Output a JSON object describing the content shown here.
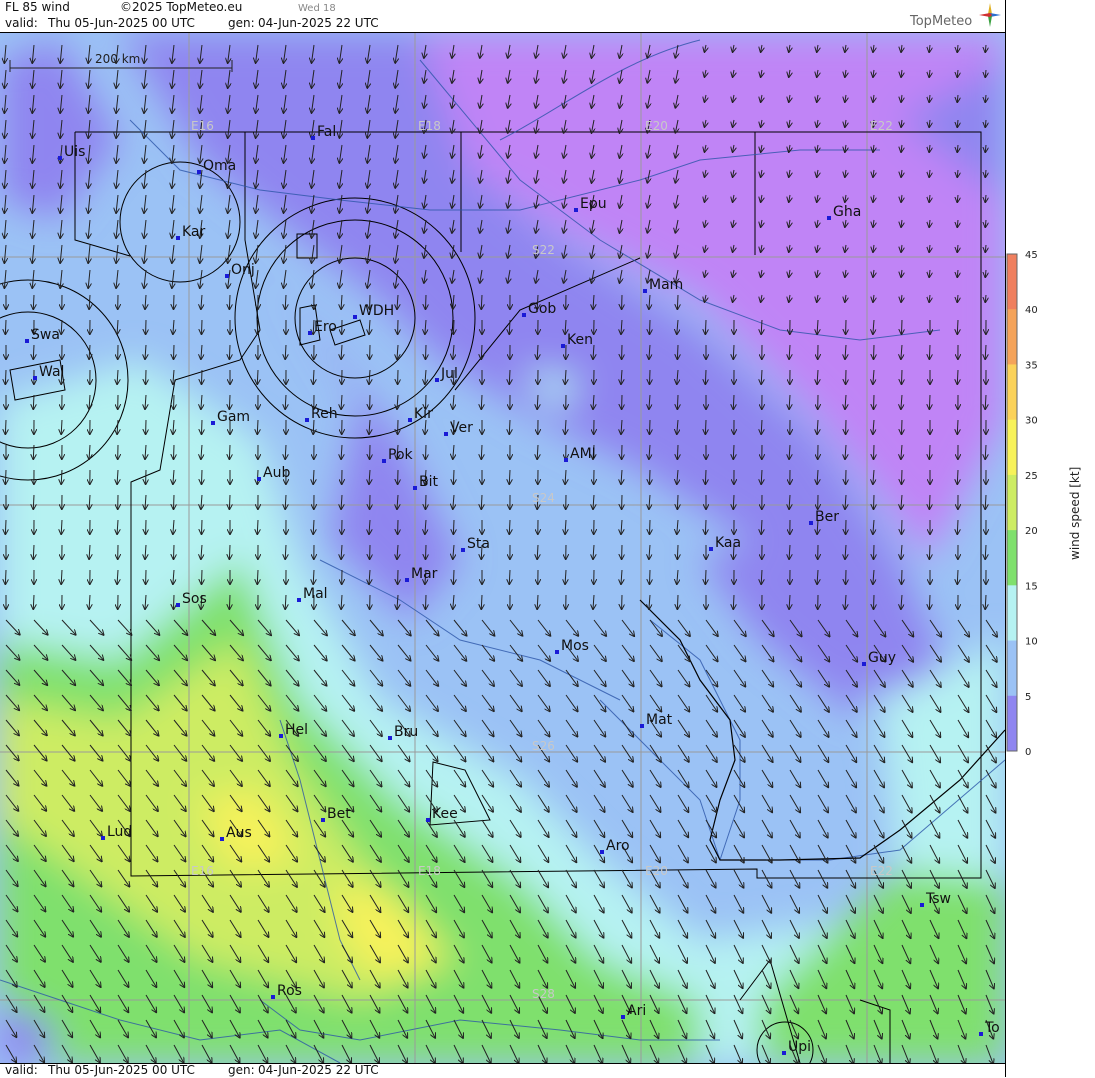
{
  "header": {
    "title": "FL 85 wind",
    "copyright": "©2025 TopMeteo.eu",
    "valid_label": "valid:",
    "valid_value": "Thu  05-Jun-2025  00 UTC",
    "gen_label": "gen:",
    "gen_value": "04-Jun-2025 22 UTC",
    "watermark": "Wed 18",
    "logo": "TopMeteo"
  },
  "footer": {
    "valid_label": "valid:",
    "valid_value": "Thu  05-Jun-2025  00 UTC",
    "gen_label": "gen:",
    "gen_value": "04-Jun-2025 22 UTC"
  },
  "scale_bar": {
    "label": "200 km"
  },
  "legend": {
    "title": "wind  speed  [kt]",
    "ticks": [
      "45",
      "40",
      "35",
      "30",
      "25",
      "20",
      "15",
      "10",
      "5",
      "0"
    ],
    "colors": [
      "#ef7f5e",
      "#f4a35a",
      "#fbd25a",
      "#f7f25a",
      "#cdec63",
      "#7fe06d",
      "#b6f2f2",
      "#9bc2f5",
      "#8f85f0",
      "#c084f6"
    ]
  },
  "grid_labels": {
    "lon": [
      "E16",
      "E18",
      "E20",
      "E22"
    ],
    "lat": [
      "S22",
      "S24",
      "S26",
      "S28"
    ]
  },
  "places": [
    {
      "name": "Uis"
    },
    {
      "name": "Oma"
    },
    {
      "name": "Fal"
    },
    {
      "name": "Kar"
    },
    {
      "name": "Onj"
    },
    {
      "name": "Epu"
    },
    {
      "name": "Gha"
    },
    {
      "name": "Mam"
    },
    {
      "name": "Gob"
    },
    {
      "name": "Ken"
    },
    {
      "name": "Swa"
    },
    {
      "name": "Wal"
    },
    {
      "name": "Ero"
    },
    {
      "name": "WDH"
    },
    {
      "name": "Jul"
    },
    {
      "name": "Gam"
    },
    {
      "name": "Reh"
    },
    {
      "name": "Kir"
    },
    {
      "name": "Ver"
    },
    {
      "name": "Pok"
    },
    {
      "name": "AMI"
    },
    {
      "name": "Bit"
    },
    {
      "name": "Aub"
    },
    {
      "name": "Ber"
    },
    {
      "name": "Sta"
    },
    {
      "name": "Kaa"
    },
    {
      "name": "Mar"
    },
    {
      "name": "Sos"
    },
    {
      "name": "Mal"
    },
    {
      "name": "Mos"
    },
    {
      "name": "Guy"
    },
    {
      "name": "Mat"
    },
    {
      "name": "Hel"
    },
    {
      "name": "Bru"
    },
    {
      "name": "Bet"
    },
    {
      "name": "Kee"
    },
    {
      "name": "Lud"
    },
    {
      "name": "Aus"
    },
    {
      "name": "Aro"
    },
    {
      "name": "Tsw"
    },
    {
      "name": "Ros"
    },
    {
      "name": "Ari"
    },
    {
      "name": "Upi"
    },
    {
      "name": "To"
    }
  ]
}
